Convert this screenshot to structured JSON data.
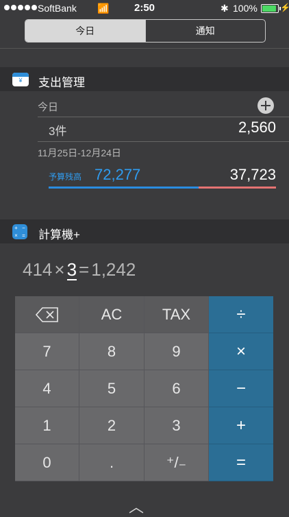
{
  "status_bar": {
    "carrier": "SoftBank",
    "wifi_icon": "📶",
    "time": "2:50",
    "bluetooth_icon": "✱",
    "battery_percent": "100%",
    "charging_icon": "⚡",
    "battery_color": "#4cd964"
  },
  "segmented": {
    "today": "今日",
    "notifications": "通知"
  },
  "expense_widget": {
    "title": "支出管理",
    "icon_glyph": "¥",
    "today_label": "今日",
    "count": "3件",
    "total": "2,560",
    "period": "11月25日-12月24日",
    "budget_label": "予算残高",
    "budget_remaining": "72,277",
    "spent": "37,723",
    "colors": {
      "budget": "#2f9cf0",
      "spent_bar": "#e57373"
    }
  },
  "calculator_widget": {
    "title": "計算機+",
    "icon_glyphs": [
      "+",
      "−",
      "×",
      "="
    ],
    "expression": {
      "left": "414",
      "op": "×",
      "current": "3",
      "equals": "=",
      "result": "1,242"
    },
    "keys": [
      {
        "label": "",
        "name": "backspace-key",
        "kind": "top",
        "icon": "backspace-icon"
      },
      {
        "label": "AC",
        "name": "key-ac",
        "kind": "top"
      },
      {
        "label": "TAX",
        "name": "key-tax",
        "kind": "top"
      },
      {
        "label": "÷",
        "name": "key-divide",
        "kind": "op"
      },
      {
        "label": "7",
        "name": "key-7",
        "kind": "num"
      },
      {
        "label": "8",
        "name": "key-8",
        "kind": "num"
      },
      {
        "label": "9",
        "name": "key-9",
        "kind": "num"
      },
      {
        "label": "×",
        "name": "key-multiply",
        "kind": "op"
      },
      {
        "label": "4",
        "name": "key-4",
        "kind": "num"
      },
      {
        "label": "5",
        "name": "key-5",
        "kind": "num"
      },
      {
        "label": "6",
        "name": "key-6",
        "kind": "num"
      },
      {
        "label": "−",
        "name": "key-subtract",
        "kind": "op"
      },
      {
        "label": "1",
        "name": "key-1",
        "kind": "num"
      },
      {
        "label": "2",
        "name": "key-2",
        "kind": "num"
      },
      {
        "label": "3",
        "name": "key-3",
        "kind": "num"
      },
      {
        "label": "+",
        "name": "key-add",
        "kind": "op"
      },
      {
        "label": "0",
        "name": "key-0",
        "kind": "num"
      },
      {
        "label": ".",
        "name": "key-decimal",
        "kind": "num"
      },
      {
        "label": "⁺/₋",
        "name": "key-plus-minus",
        "kind": "num"
      },
      {
        "label": "=",
        "name": "key-equals",
        "kind": "op"
      }
    ],
    "operator_color": "#2b6e95"
  },
  "handle_icon": "︿"
}
